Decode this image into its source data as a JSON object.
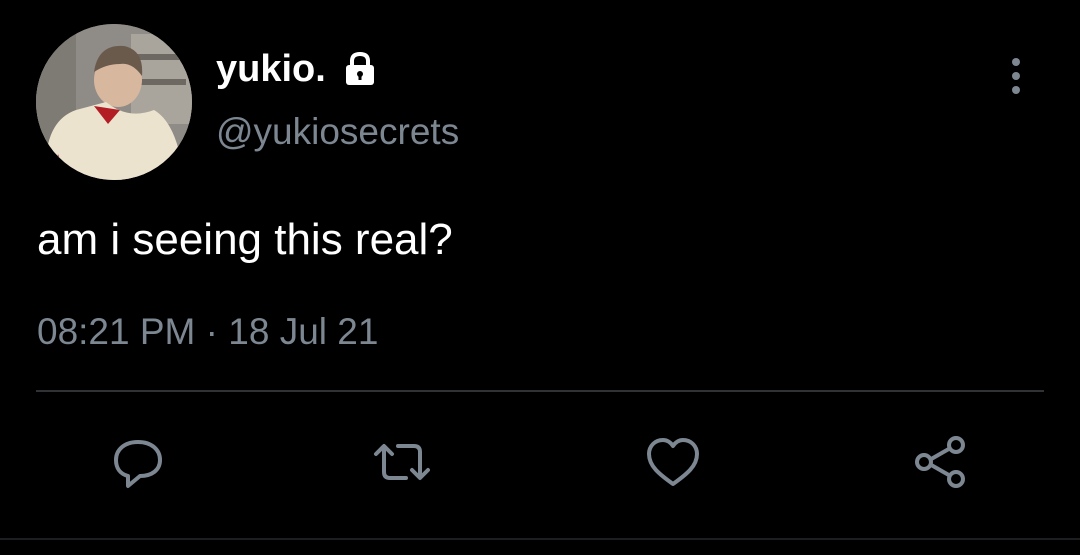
{
  "tweet": {
    "display_name": "yukio.",
    "handle": "@yukiosecrets",
    "text": "am i seeing this real?",
    "time": "08:21 PM",
    "separator": "·",
    "date": "18 Jul 21"
  },
  "icons": {
    "protected": "lock-icon",
    "more": "more-vertical-icon",
    "reply": "reply-icon",
    "retweet": "retweet-icon",
    "like": "heart-icon",
    "share": "share-icon"
  },
  "colors": {
    "background": "#000000",
    "text_primary": "#ffffff",
    "text_secondary": "#7d8791",
    "divider": "#2f3336",
    "icon": "#7d8791"
  }
}
